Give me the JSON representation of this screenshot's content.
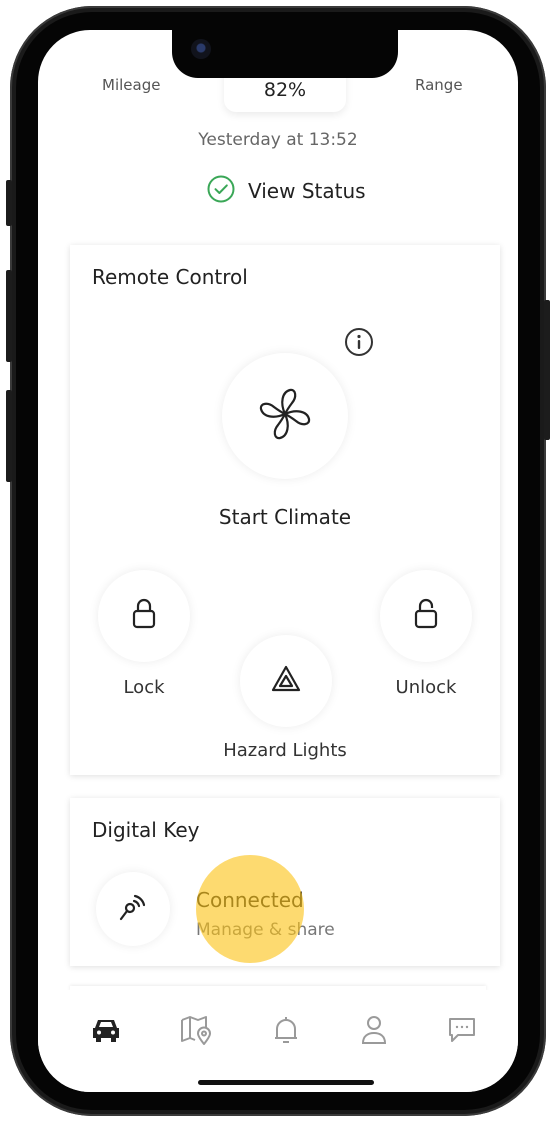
{
  "status": {
    "mileage_label": "Mileage",
    "percent": "82%",
    "range_label": "Range",
    "updated": "Yesterday at 13:52",
    "view_status": "View Status"
  },
  "remote_control": {
    "title": "Remote Control",
    "start_climate": "Start Climate",
    "lock": "Lock",
    "unlock": "Unlock",
    "hazard_lights": "Hazard Lights"
  },
  "digital_key": {
    "title": "Digital Key",
    "status": "Connected",
    "subtitle": "Manage & share"
  },
  "bottom_nav": {
    "items": [
      "car-icon",
      "map-icon",
      "bell-icon",
      "person-icon",
      "chat-icon"
    ]
  },
  "colors": {
    "accent_green": "#3aa757",
    "tap_highlight": "#fcc419"
  }
}
